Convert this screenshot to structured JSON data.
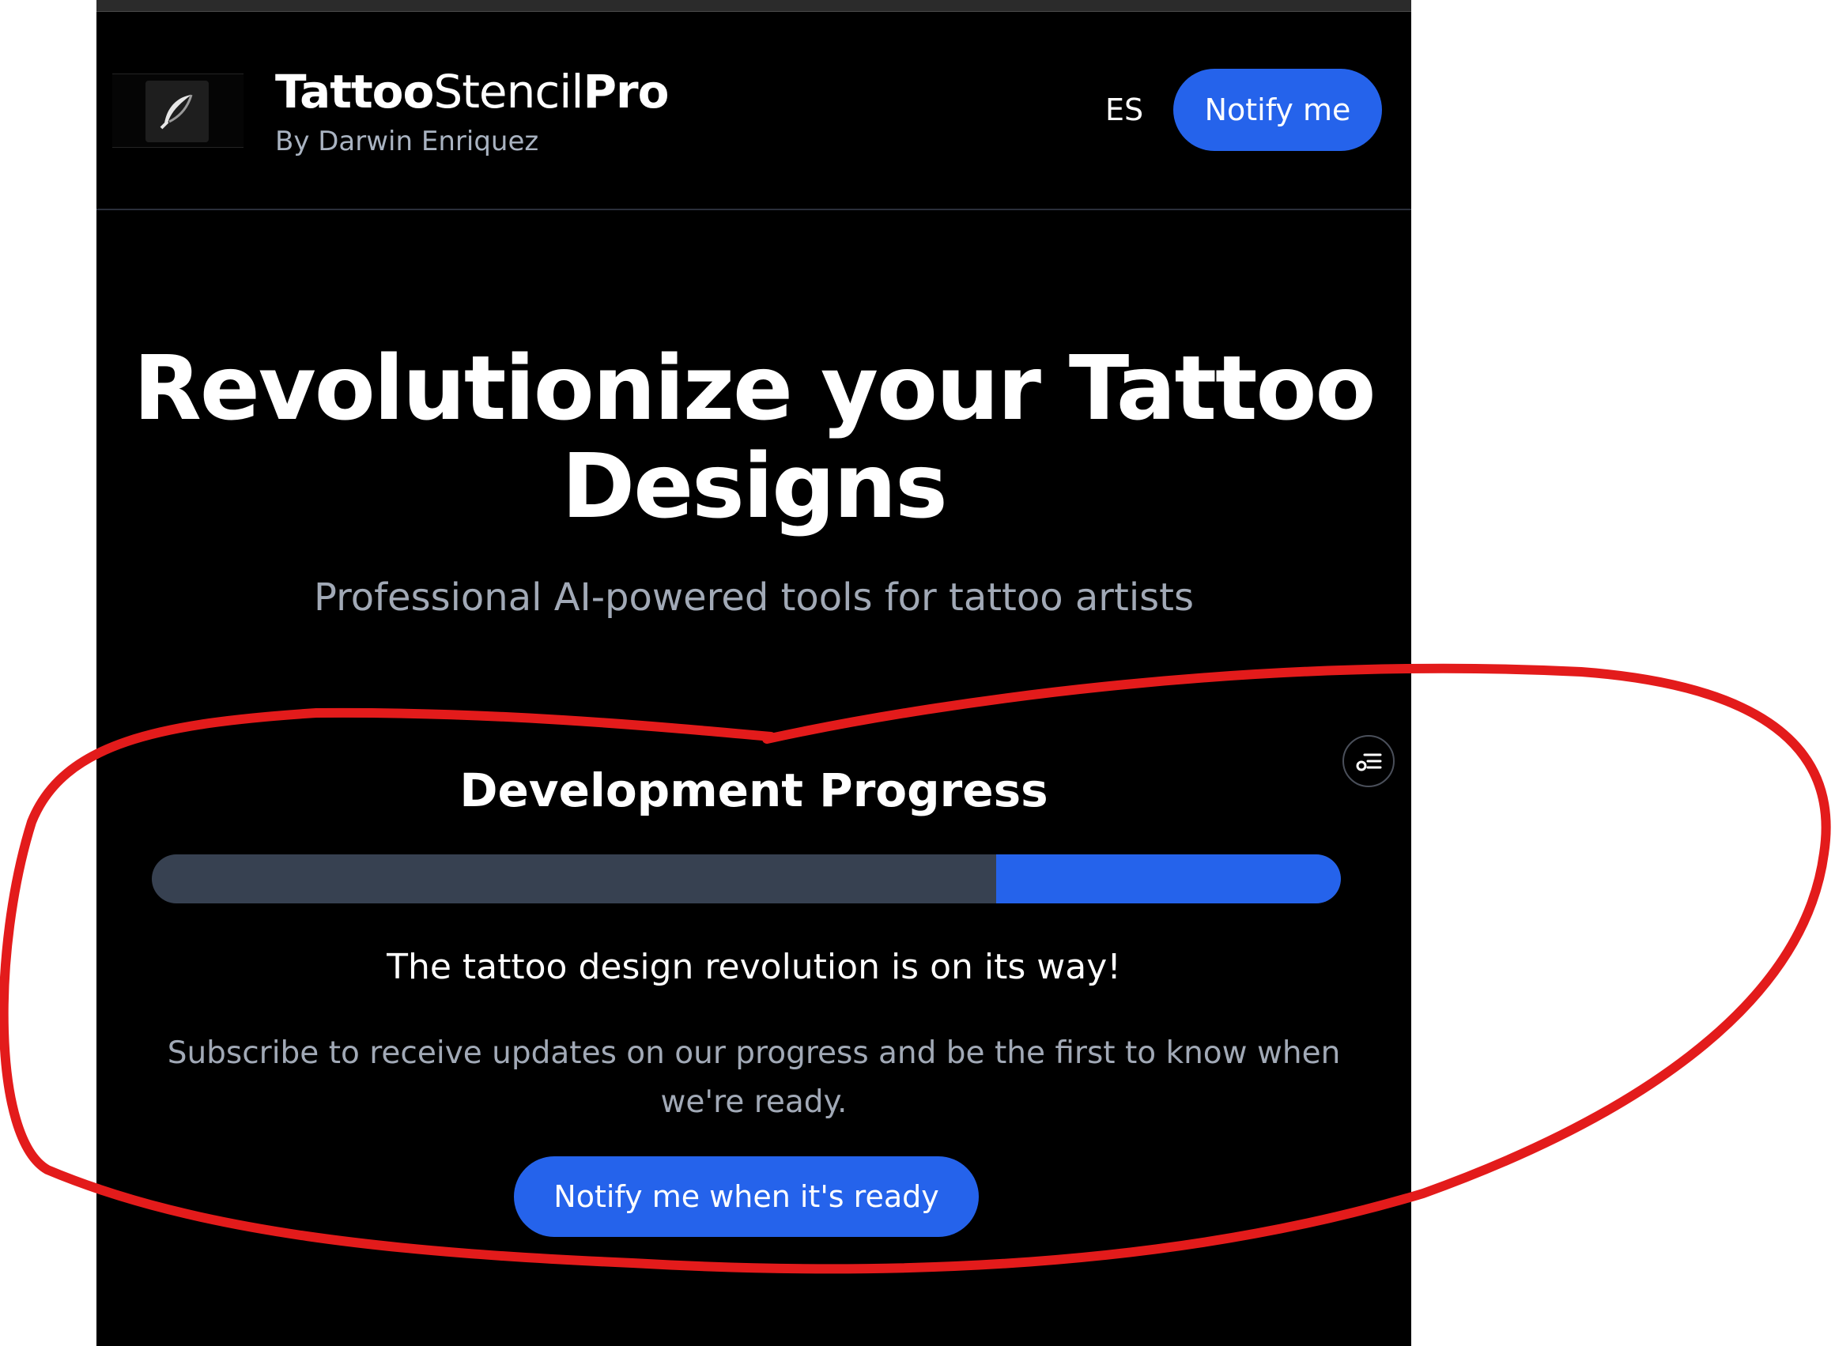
{
  "header": {
    "brand_part1": "Tattoo",
    "brand_part2": "Stencil",
    "brand_part3": "Pro",
    "byline": "By Darwin Enriquez",
    "language_label": "ES",
    "notify_button_label": "Notify me",
    "logo_icon": "feather-icon"
  },
  "hero": {
    "title": "Revolutionize your Tattoo Designs",
    "subtitle": "Professional AI-powered tools for tattoo artists"
  },
  "progress_section": {
    "title": "Development Progress",
    "progress_percent": 29,
    "tagline": "The tattoo design revolution is on its way!",
    "description": "Subscribe to receive updates on our progress and be the first to know when we're ready.",
    "cta_label": "Notify me when it's ready"
  },
  "floating_button": {
    "icon": "filter-list-icon"
  },
  "colors": {
    "accent": "#2563eb",
    "track": "#374151",
    "background": "#000000",
    "muted_text": "#a1a9b6",
    "annotation": "#e31b1b"
  }
}
